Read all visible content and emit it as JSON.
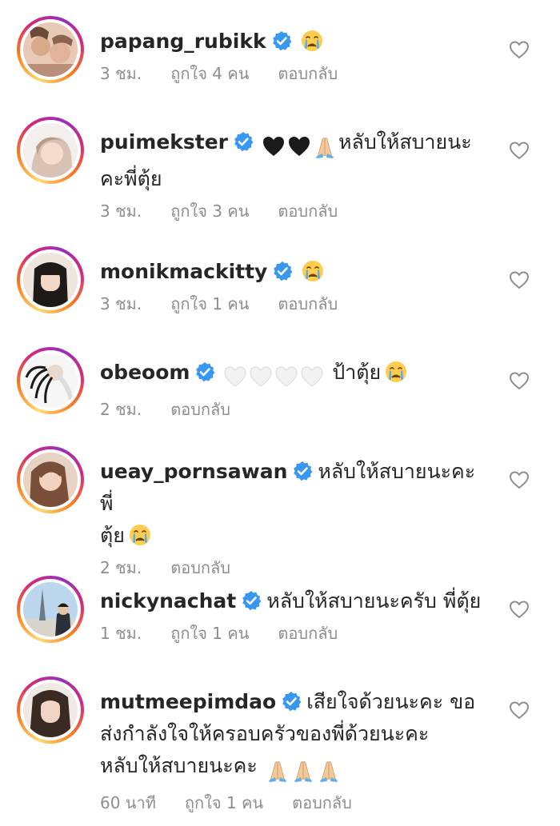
{
  "comments": [
    {
      "username": "papang_rubikk",
      "text": "",
      "emojis": [
        "crying-face-emoji"
      ],
      "time": "3 ชม.",
      "likes": "ถูกใจ 4 คน",
      "reply": "ตอบกลับ"
    },
    {
      "username": "puimekster",
      "text_pre": "",
      "emojis": [
        "black-heart-emoji",
        "black-heart-emoji",
        "folded-hands-emoji"
      ],
      "text": "หลับให้สบายนะ",
      "text_line2": "คะพี่ตุ้ย",
      "time": "3 ชม.",
      "likes": "ถูกใจ 3 คน",
      "reply": "ตอบกลับ"
    },
    {
      "username": "monikmackitty",
      "text": "",
      "emojis": [
        "crying-face-emoji"
      ],
      "time": "3 ชม.",
      "likes": "ถูกใจ 1 คน",
      "reply": "ตอบกลับ"
    },
    {
      "username": "obeoom",
      "emojis": [
        "white-heart-emoji",
        "white-heart-emoji",
        "white-heart-emoji",
        "white-heart-emoji"
      ],
      "text": "ป้าตุ้ย",
      "emojis_after": [
        "crying-face-emoji"
      ],
      "time": "2 ชม.",
      "reply": "ตอบกลับ"
    },
    {
      "username": "ueay_pornsawan",
      "text": "หลับให้สบายนะคะพี่",
      "text_line2": "ตุ้ย",
      "emojis_after": [
        "crying-face-emoji"
      ],
      "time": "2 ชม.",
      "reply": "ตอบกลับ"
    },
    {
      "username": "nickynachat",
      "text": "หลับให้สบายนะครับ พี่ตุ้ย",
      "time": "1 ชม.",
      "likes": "ถูกใจ 1 คน",
      "reply": "ตอบกลับ"
    },
    {
      "username": "mutmeepimdao",
      "text": "เสียใจด้วยนะคะ ขอ",
      "text_line2": "ส่งกำลังใจให้ครอบครัวของพี่ด้วยนะคะ",
      "text_line3": "หลับให้สบายนะคะ",
      "emojis_after": [
        "folded-hands-emoji",
        "folded-hands-emoji",
        "folded-hands-emoji"
      ],
      "time": "60 นาที",
      "likes": "ถูกใจ 1 คน",
      "reply": "ตอบกลับ"
    }
  ],
  "colors": {
    "text": "#262626",
    "meta": "#8e8e8e",
    "verified": "#3897f0",
    "heart_outline": "#8e8e8e"
  },
  "icons": {
    "verified": "verified-badge-icon",
    "like": "heart-outline-icon"
  }
}
